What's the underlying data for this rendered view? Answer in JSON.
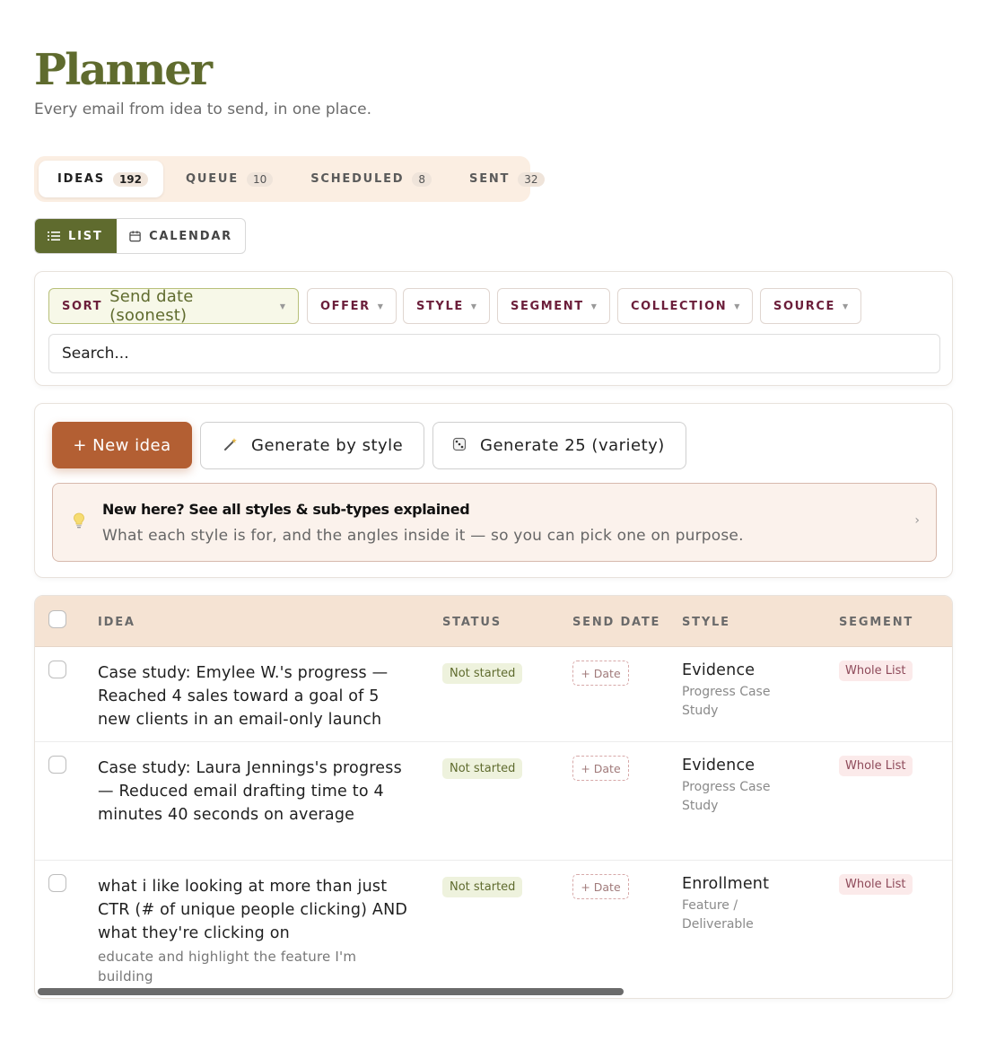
{
  "page": {
    "title": "Planner",
    "subtitle": "Every email from idea to send, in one place."
  },
  "tabs": [
    {
      "label": "IDEAS",
      "count": "192",
      "active": true
    },
    {
      "label": "QUEUE",
      "count": "10",
      "active": false
    },
    {
      "label": "SCHEDULED",
      "count": "8",
      "active": false
    },
    {
      "label": "SENT",
      "count": "32",
      "active": false
    }
  ],
  "view_toggle": {
    "list_label": "LIST",
    "calendar_label": "CALENDAR",
    "selected": "LIST"
  },
  "filters": {
    "sort_label": "SORT",
    "sort_value": "Send date (soonest)",
    "chips": [
      "OFFER",
      "STYLE",
      "SEGMENT",
      "COLLECTION",
      "SOURCE"
    ],
    "search_placeholder": "Search..."
  },
  "actions": {
    "new_idea": "+ New idea",
    "generate_by_style": "Generate by style",
    "generate_variety": "Generate 25 (variety)"
  },
  "help_banner": {
    "title": "New here? See all styles & sub-types explained",
    "description": "What each style is for, and the angles inside it — so you can pick one on purpose."
  },
  "table": {
    "headers": {
      "idea": "IDEA",
      "status": "STATUS",
      "send_date": "SEND DATE",
      "style": "STYLE",
      "segment": "SEGMENT"
    },
    "rows": [
      {
        "idea": "Case study: Emylee W.'s progress — Reached 4 sales toward a goal of 5 new clients in an email-only launch",
        "note": "",
        "status": "Not started",
        "date_button": "+ Date",
        "style": "Evidence",
        "sub_type": "Progress Case Study",
        "segment": "Whole List"
      },
      {
        "idea": "Case study: Laura Jennings's progress — Reduced email drafting time to 4 minutes 40 seconds on average",
        "note": "",
        "status": "Not started",
        "date_button": "+ Date",
        "style": "Evidence",
        "sub_type": "Progress Case Study",
        "segment": "Whole List"
      },
      {
        "idea": "what i like looking at more than just CTR (# of unique people clicking) AND what they're clicking on",
        "note": "educate and highlight the feature I'm building",
        "status": "Not started",
        "date_button": "+ Date",
        "style": "Enrollment",
        "sub_type": "Feature / Deliverable",
        "segment": "Whole List"
      }
    ]
  },
  "colors": {
    "brand_olive": "#5f6b2e",
    "accent_rust": "#b35f33",
    "tab_bar_bg": "#fbeee2",
    "table_header_bg": "#f5e3d3",
    "chip_text": "#6b1e3a"
  }
}
